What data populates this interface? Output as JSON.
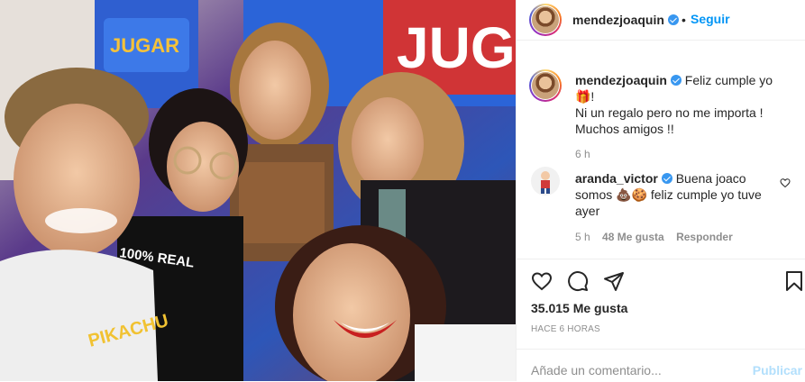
{
  "post": {
    "username": "mendezjoaquin",
    "follow_label": "Seguir",
    "separator": "•",
    "caption_line1": "Feliz cumple yo 🎁!",
    "caption_line2": "Ni un regalo pero no me importa !",
    "caption_line3": "Muchos amigos !!",
    "caption_time": "6 h",
    "photo_text_banner_left": "JUGAR",
    "photo_text_banner_right": "JUG",
    "photo_shirt_text": "100% REAL",
    "photo_shirt_text2": "PIKACHU"
  },
  "comment": {
    "username": "aranda_victor",
    "text_line1": "Buena joaco",
    "text_line2": "somos 💩🍪 feliz cumple yo tuve",
    "text_line3": "ayer",
    "time": "5 h",
    "likes": "48 Me gusta",
    "reply_label": "Responder"
  },
  "actions": {
    "likes_count": "35.015 Me gusta",
    "posted_ago": "HACE 6 HORAS"
  },
  "add_comment": {
    "placeholder": "Añade un comentario...",
    "publish_label": "Publicar"
  },
  "icons": [
    "heart-icon",
    "comment-icon",
    "share-icon",
    "bookmark-icon",
    "verified-icon",
    "comment-heart-icon"
  ],
  "colors": {
    "accent": "#0095f6",
    "verified": "#3897f0",
    "muted": "#8e8e8e",
    "publish_disabled": "#b2dffc"
  }
}
